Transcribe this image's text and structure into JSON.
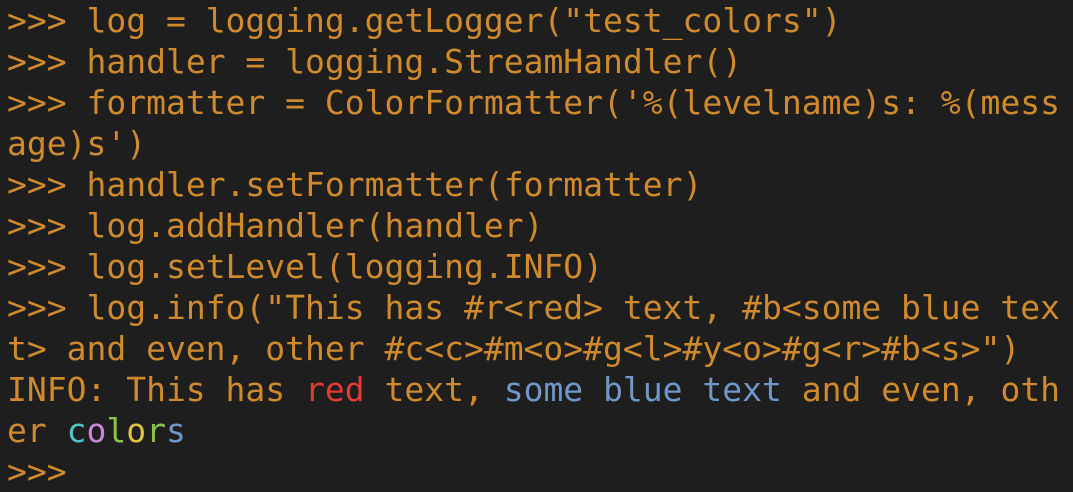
{
  "terminal": {
    "prompt": ">>> ",
    "lines": [
      {
        "prompt": ">>> ",
        "code": "log = logging.getLogger(\"test_colors\")"
      },
      {
        "prompt": ">>> ",
        "code": "handler = logging.StreamHandler()"
      },
      {
        "prompt": ">>> ",
        "code": "formatter = ColorFormatter('%(levelname)s: %(mess"
      },
      {
        "prompt": "",
        "code": "age)s')"
      },
      {
        "prompt": ">>> ",
        "code": "handler.setFormatter(formatter)"
      },
      {
        "prompt": ">>> ",
        "code": "log.addHandler(handler)"
      },
      {
        "prompt": ">>> ",
        "code": "log.setLevel(logging.INFO)"
      },
      {
        "prompt": ">>> ",
        "code": "log.info(\"This has #r<red> text, #b<some blue tex"
      },
      {
        "prompt": "",
        "code": "t> and even, other #c<c>#m<o>#g<l>#y<o>#g<r>#b<s>\")"
      }
    ],
    "output": {
      "line1": {
        "prefix": "INFO: This has ",
        "red_word": "red",
        "middle": " text, ",
        "blue_1": "some",
        "space_1": " ",
        "blue_2": "blue",
        "space_2": " ",
        "blue_3": "text",
        "suffix": " and even, oth"
      },
      "line2": {
        "prefix": "er ",
        "c1": "c",
        "c2": "o",
        "c3": "l",
        "c4": "o",
        "c5": "r",
        "c6": "s"
      }
    },
    "final_prompt": ">>>",
    "colors": {
      "background": "#1e1e1e",
      "default_text": "#d08a2e",
      "red": "#e53935",
      "blue": "#6f97c9",
      "cyan": "#4fc5c8",
      "magenta": "#c987d8",
      "green": "#8bc34a",
      "yellow": "#e0c246"
    }
  }
}
